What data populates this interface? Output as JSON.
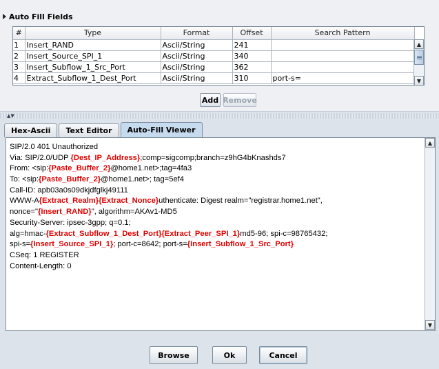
{
  "auto_fill": {
    "title": "Auto Fill Fields",
    "columns": [
      "#",
      "Type",
      "Format",
      "Offset",
      "Search Pattern"
    ],
    "rows": [
      {
        "num": "1",
        "type": "Insert_RAND",
        "format": "Ascii/String",
        "offset": "241",
        "pattern": ""
      },
      {
        "num": "2",
        "type": "Insert_Source_SPI_1",
        "format": "Ascii/String",
        "offset": "340",
        "pattern": ""
      },
      {
        "num": "3",
        "type": "Insert_Subflow_1_Src_Port",
        "format": "Ascii/String",
        "offset": "362",
        "pattern": ""
      },
      {
        "num": "4",
        "type": "Extract_Subflow_1_Dest_Port",
        "format": "Ascii/String",
        "offset": "310",
        "pattern": "port-s="
      }
    ],
    "add_label": "Add",
    "remove_label": "Remove"
  },
  "tabs": [
    {
      "label": "Hex-Ascii",
      "active": false
    },
    {
      "label": "Text Editor",
      "active": false
    },
    {
      "label": "Auto-Fill Viewer",
      "active": true
    }
  ],
  "editor": {
    "lines": [
      [
        {
          "t": "SIP/2.0 401 Unauthorized",
          "red": false
        }
      ],
      [
        {
          "t": "Via: SIP/2.0/UDP ",
          "red": false
        },
        {
          "t": "{Dest_IP_Address}",
          "red": true
        },
        {
          "t": ";comp=sigcomp;branch=z9hG4bKnashds7",
          "red": false
        }
      ],
      [
        {
          "t": "From: <sip:",
          "red": false
        },
        {
          "t": "{Paste_Buffer_2}",
          "red": true
        },
        {
          "t": "@home1.net>;tag=4fa3",
          "red": false
        }
      ],
      [
        {
          "t": "To: <sip:",
          "red": false
        },
        {
          "t": "{Paste_Buffer_2}",
          "red": true
        },
        {
          "t": "@home1.net>; tag=5ef4",
          "red": false
        }
      ],
      [
        {
          "t": "Call-ID: apb03a0s09dkjdfglkj49111",
          "red": false
        }
      ],
      [
        {
          "t": "WWW-A",
          "red": false
        },
        {
          "t": "{Extract_Realm}{Extract_Nonce}",
          "red": true
        },
        {
          "t": "uthenticate: Digest realm=\"registrar.home1.net\",",
          "red": false
        }
      ],
      [
        {
          "t": "nonce=\"",
          "red": false
        },
        {
          "t": "{Insert_RAND}",
          "red": true
        },
        {
          "t": "\", algorithm=AKAv1-MD5",
          "red": false
        }
      ],
      [
        {
          "t": "Security-Server: ipsec-3gpp; q=0.1;",
          "red": false
        }
      ],
      [
        {
          "t": "alg=hmac-",
          "red": false
        },
        {
          "t": "{Extract_Subflow_1_Dest_Port}{Extract_Peer_SPI_1}",
          "red": true
        },
        {
          "t": "md5-96; spi-c=98765432;",
          "red": false
        }
      ],
      [
        {
          "t": "spi-s=",
          "red": false
        },
        {
          "t": "{Insert_Source_SPI_1}",
          "red": true
        },
        {
          "t": "; port-c=8642; port-s=",
          "red": false
        },
        {
          "t": "{Insert_Subflow_1_Src_Port}",
          "red": true
        }
      ],
      [
        {
          "t": "CSeq: 1 REGISTER",
          "red": false
        }
      ],
      [
        {
          "t": "Content-Length: 0",
          "red": false
        }
      ]
    ]
  },
  "buttons": {
    "browse": "Browse",
    "ok": "Ok",
    "cancel": "Cancel"
  },
  "colors": {
    "field_highlight": "#e00000",
    "active_tab": "#c7dbef"
  }
}
